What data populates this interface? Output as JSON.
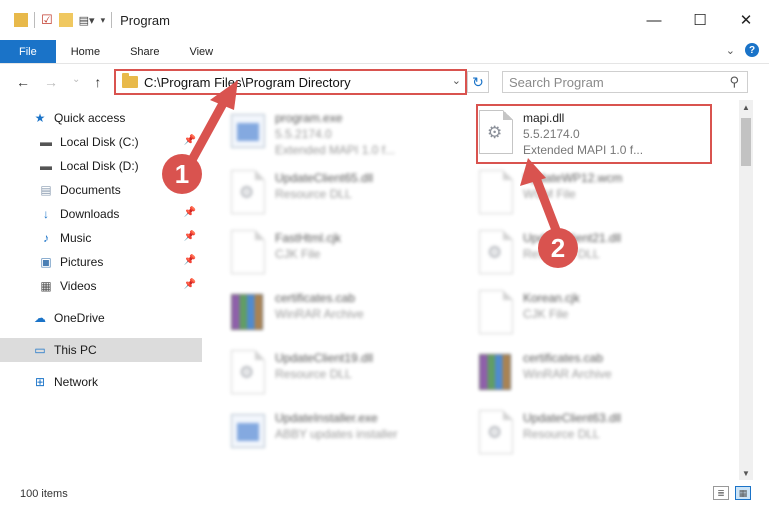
{
  "window": {
    "title": "Program",
    "minimize": "—",
    "maximize": "☐",
    "close": "✕"
  },
  "ribbon": {
    "tabs": [
      "File",
      "Home",
      "Share",
      "View"
    ],
    "help": "?"
  },
  "address_bar": {
    "path": "C:\\Program Files\\Program Directory",
    "search_placeholder": "Search Program"
  },
  "sidebar": {
    "items": [
      {
        "label": "Quick access",
        "icon": "star-icon"
      },
      {
        "label": "Local Disk (C:)",
        "icon": "drive-icon"
      },
      {
        "label": "Local Disk (D:)",
        "icon": "drive-icon"
      },
      {
        "label": "Documents",
        "icon": "documents-icon"
      },
      {
        "label": "Downloads",
        "icon": "download-icon"
      },
      {
        "label": "Music",
        "icon": "music-icon"
      },
      {
        "label": "Pictures",
        "icon": "pictures-icon"
      },
      {
        "label": "Videos",
        "icon": "videos-icon"
      },
      {
        "label": "OneDrive",
        "icon": "cloud-icon"
      },
      {
        "label": "This PC",
        "icon": "computer-icon"
      },
      {
        "label": "Network",
        "icon": "network-icon"
      }
    ]
  },
  "files": [
    {
      "name": "program.exe",
      "line2": "5.5.2174.0",
      "line3": "Extended MAPI 1.0 f...",
      "icon": "exe"
    },
    {
      "name": "mapi.dll",
      "line2": "5.5.2174.0",
      "line3": "Extended MAPI 1.0 f...",
      "icon": "dll"
    },
    {
      "name": "UpdateClient65.dll",
      "line2": "Resource DLL",
      "icon": "dll"
    },
    {
      "name": "UpdateWP12.wcm",
      "line2": "WCM File",
      "icon": "doc"
    },
    {
      "name": "FastHtml.cjk",
      "line2": "CJK File",
      "icon": "doc"
    },
    {
      "name": "UpdateClient21.dll",
      "line2": "Resource DLL",
      "icon": "dll"
    },
    {
      "name": "certificates.cab",
      "line2": "WinRAR Archive",
      "icon": "rar"
    },
    {
      "name": "Korean.cjk",
      "line2": "CJK File",
      "icon": "doc"
    },
    {
      "name": "UpdateClient19.dll",
      "line2": "Resource DLL",
      "icon": "dll"
    },
    {
      "name": "certificates.cab",
      "line2": "WinRAR Archive",
      "icon": "rar"
    },
    {
      "name": "UpdateInstaller.exe",
      "line2": "ABBY updates installer",
      "icon": "exe"
    },
    {
      "name": "UpdateClient63.dll",
      "line2": "Resource DLL",
      "icon": "dll"
    }
  ],
  "status": {
    "item_count": "100 items"
  },
  "annotations": {
    "step1": "1",
    "step2": "2"
  }
}
